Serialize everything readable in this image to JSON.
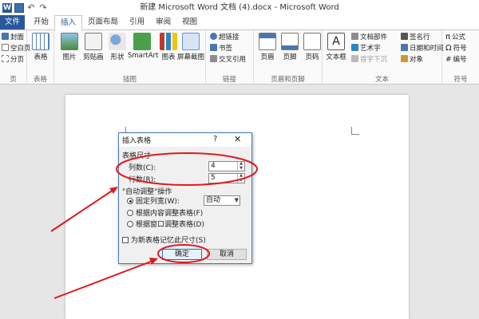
{
  "titlebar": {
    "title": "新建 Microsoft Word 文档 (4).docx - Microsoft Word",
    "word_icon": "W"
  },
  "tabs": [
    {
      "label": "文件"
    },
    {
      "label": "开始"
    },
    {
      "label": "插入"
    },
    {
      "label": "页面布局"
    },
    {
      "label": "引用"
    },
    {
      "label": "审阅"
    },
    {
      "label": "视图"
    }
  ],
  "ribbon": {
    "pages": {
      "items": [
        "封面",
        "空白页",
        "分页"
      ],
      "label": "页"
    },
    "tables": {
      "button": "表格",
      "label": "表格"
    },
    "illustrations": {
      "buttons": [
        "图片",
        "剪贴画",
        "形状",
        "SmartArt",
        "图表",
        "屏幕截图"
      ],
      "label": "插图"
    },
    "links": {
      "items": [
        "超链接",
        "书签",
        "交叉引用"
      ],
      "label": "链接"
    },
    "header_footer": {
      "buttons": [
        "页眉",
        "页脚",
        "页码"
      ],
      "label": "页眉和页脚"
    },
    "text": {
      "textbox": "文本框",
      "items": [
        "文档部件",
        "艺术字",
        "首字下沉",
        "签名行",
        "日期和时间",
        "对象"
      ],
      "label": "文本"
    },
    "symbols": {
      "items": [
        "公式",
        "符号",
        "编号"
      ],
      "label": "符号"
    }
  },
  "dialog": {
    "title": "插入表格",
    "help": "?",
    "close": "✕",
    "table_size_label": "表格尺寸",
    "columns_label": "列数(C):",
    "columns_value": "4",
    "rows_label": "行数(R):",
    "rows_value": "5",
    "autofit_label": "\"自动调整\"操作",
    "fixed_width_label": "固定列宽(W):",
    "fixed_width_value": "自动",
    "fit_content_label": "根据内容调整表格(F)",
    "fit_window_label": "根据窗口调整表格(D)",
    "remember_label": "为新表格记忆此尺寸(S)",
    "ok_label": "确定",
    "cancel_label": "取消"
  },
  "colors": {
    "accent": "#2b579a",
    "annotation": "#e0191e"
  }
}
